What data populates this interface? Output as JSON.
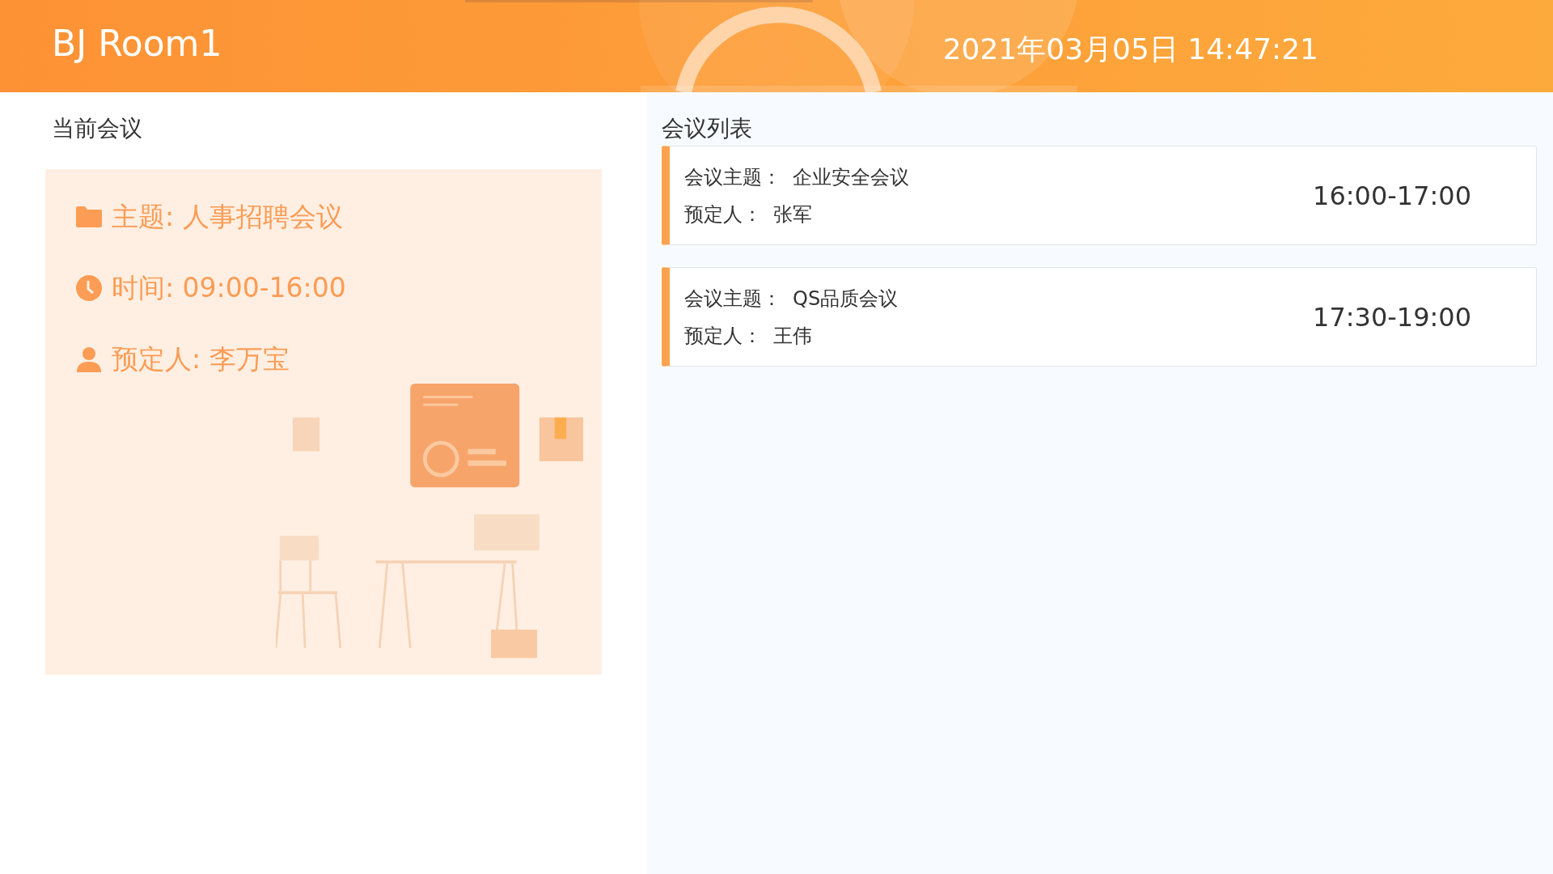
{
  "header": {
    "room": "BJ Room1",
    "datetime": "2021年03月05日 14:47:21"
  },
  "current_meeting": {
    "title": "当前会议",
    "rows": [
      {
        "kind": "folder",
        "text": "主题: 人事招聘会议"
      },
      {
        "kind": "clock",
        "text": "时间: 09:00-16:00"
      },
      {
        "kind": "person",
        "text": "预定人: 李万宝"
      }
    ]
  },
  "meeting_list": {
    "title": "会议列表",
    "items": [
      {
        "subject_label": "会议主题：",
        "subject": "企业安全会议",
        "booker_label": "预定人：",
        "booker": "张军",
        "time": "16:00-17:00"
      },
      {
        "subject_label": "会议主题：",
        "subject": "QS品质会议",
        "booker_label": "预定人：",
        "booker": "王伟",
        "time": "17:30-19:00"
      }
    ]
  }
}
